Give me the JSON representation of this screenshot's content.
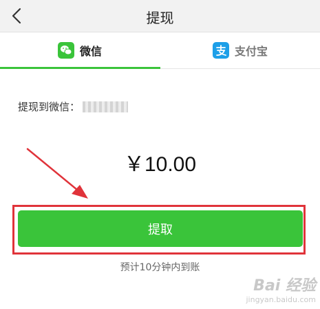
{
  "header": {
    "title": "提现"
  },
  "tabs": [
    {
      "label": "微信",
      "active": true
    },
    {
      "label": "支付宝",
      "active": false
    }
  ],
  "account": {
    "label": "提现到微信："
  },
  "amount": {
    "display": "￥10.00"
  },
  "action": {
    "button_label": "提取"
  },
  "note": {
    "eta": "预计10分钟内到账"
  },
  "watermark": {
    "main": "Bai 经验",
    "sub": "jingyan.baidu.com"
  },
  "colors": {
    "accent_green": "#3ac43a",
    "annotation_red": "#e0333a",
    "alipay_blue": "#1d9fe8"
  },
  "icons": [
    "back-chevron-icon",
    "wechat-icon",
    "alipay-icon"
  ]
}
